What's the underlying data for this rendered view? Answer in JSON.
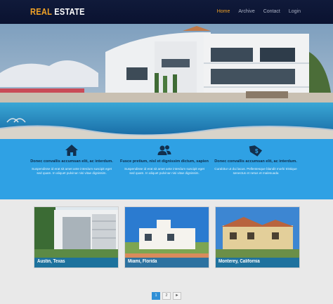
{
  "header": {
    "logo_part1": "REAL",
    "logo_part2": "ESTATE",
    "nav": [
      "Home",
      "Archive",
      "Contact",
      "Login"
    ]
  },
  "features": [
    {
      "icon": "home-icon",
      "title": "Donec convallis accumsan elit, ac interdum.",
      "text": "Suspendisse id erat sit amet ante interdum suscipit eget sed quam. In aliquet pulvinar nisi vitae dignissim."
    },
    {
      "icon": "users-icon",
      "title": "Fusce pretium, nisl et dignissim dictum, sapien",
      "text": "Suspendisse id erat sit amet ante interdum suscipit eget sed quam. In aliquet pulvinar nisi vitae dignissim."
    },
    {
      "icon": "price-tag-icon",
      "title": "Donec convallis accumsan elit, ac interdum.",
      "text": "Curabitur ut dui lacus. Pellentesque blandit morbi tristique senectus et netus et malesuada"
    }
  ],
  "listings": [
    {
      "city": "Austin, Texas"
    },
    {
      "city": "Miami, Florida"
    },
    {
      "city": "Monterey, California"
    }
  ],
  "pagination": {
    "pages": [
      "1",
      "2"
    ],
    "next": "►",
    "current": "1"
  },
  "colors": {
    "accent": "#f1a226",
    "band": "#2fa1e4",
    "header": "#0f1836"
  }
}
